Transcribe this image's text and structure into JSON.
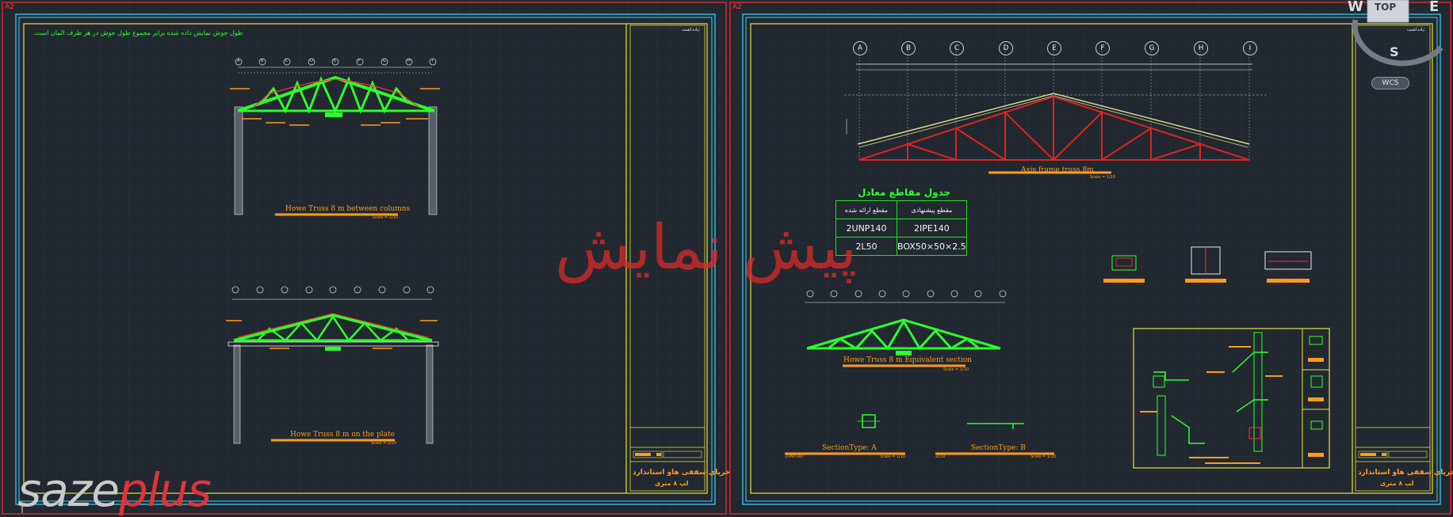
{
  "sheets": [
    {
      "tag": "A2"
    },
    {
      "tag": "A2"
    }
  ],
  "left_sheet": {
    "note": "طول جوش نمایش داده شده برابر مجموع طول جوش در هر طرف المان است.",
    "views": [
      {
        "caption": "Howe Truss 8 m between columns",
        "scale": "Scale = 1/10"
      },
      {
        "caption": "Howe Truss 8 m on the plate",
        "scale": "Scale = 1/10"
      }
    ],
    "grid_bubbles": [
      "A",
      "B",
      "C",
      "D",
      "E",
      "F",
      "G",
      "H",
      "I"
    ],
    "title_block": {
      "notes_title": "یادداشت:",
      "project_title": "خرپای سقفی هاو استاندارد",
      "project_subtitle": "لپ ۸ متری"
    }
  },
  "right_sheet": {
    "grid_bubbles": [
      "A",
      "B",
      "C",
      "D",
      "E",
      "F",
      "G",
      "H",
      "I"
    ],
    "main_view": {
      "caption": "Axis frame truss 8m",
      "scale": "Scale = 1/10"
    },
    "table": {
      "title": "جدول مقاطع معادل",
      "headers": [
        "مقطع پیشنهادی",
        "مقطع ارائه شده"
      ],
      "rows": [
        {
          "proposed": "2IPE140",
          "given": "2UNP140"
        },
        {
          "proposed": "BOX50×50×2.5",
          "given": "2L50"
        }
      ]
    },
    "equiv_view": {
      "caption": "Howe Truss 8 m Equivalent section",
      "scale": "Scale = 1/10"
    },
    "sections": [
      {
        "caption": "SectionType: A",
        "label": "2UNP140",
        "scale": "Scale = 1/10"
      },
      {
        "caption": "SectionType: B",
        "label": "2L50",
        "scale": "Scale = 1/10"
      }
    ],
    "title_block": {
      "notes_title": "یادداشت:",
      "project_title": "خرپای سقفی هاو استاندارد",
      "project_subtitle": "لپ ۸ متری"
    }
  },
  "viewcube": {
    "w": "W",
    "top": "TOP",
    "e": "E",
    "s": "S"
  },
  "wcs": "WCS",
  "logo": {
    "part1": "saze",
    "part2": "plus"
  },
  "watermark": "پیش نمایش",
  "colors": {
    "background": "#212830",
    "frame_red": "#ff2a2a",
    "frame_blue": "#35d6ff",
    "frame_yellow": "#e8e23a",
    "steel_green": "#2cff2c",
    "member_red": "#e02020",
    "caption_orange": "#ff9c1a"
  }
}
